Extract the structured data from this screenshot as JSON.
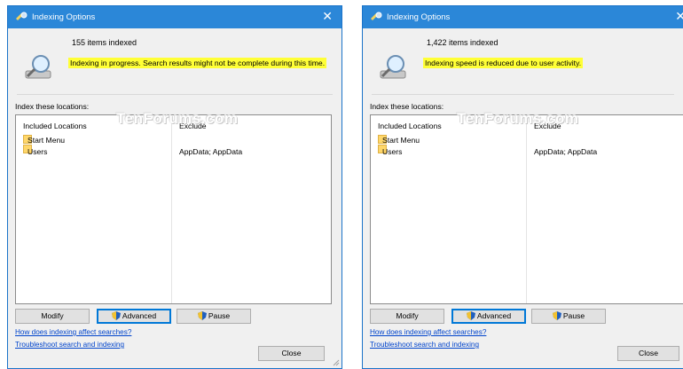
{
  "windows": [
    {
      "title": "Indexing Options",
      "close_glyph": "✕",
      "items_indexed": "155 items indexed",
      "status": "Indexing in progress. Search results might not be complete during this time.",
      "section_label": "Index these locations:",
      "columns": {
        "included": "Included Locations",
        "exclude": "Exclude"
      },
      "rows": [
        {
          "location": "Start Menu",
          "exclude": ""
        },
        {
          "location": "Users",
          "exclude": "AppData; AppData"
        }
      ],
      "watermark": "TenForums.com",
      "buttons": {
        "modify": "Modify",
        "advanced": "Advanced",
        "pause": "Pause"
      },
      "links": {
        "affect": "How does indexing affect searches?",
        "troubleshoot": "Troubleshoot search and indexing"
      },
      "close_label": "Close"
    },
    {
      "title": "Indexing Options",
      "close_glyph": "✕",
      "items_indexed": "1,422 items indexed",
      "status": "Indexing speed is reduced due to user activity.",
      "section_label": "Index these locations:",
      "columns": {
        "included": "Included Locations",
        "exclude": "Exclude"
      },
      "rows": [
        {
          "location": "Start Menu",
          "exclude": ""
        },
        {
          "location": "Users",
          "exclude": "AppData; AppData"
        }
      ],
      "watermark": "TenForums.com",
      "buttons": {
        "modify": "Modify",
        "advanced": "Advanced",
        "pause": "Pause"
      },
      "links": {
        "affect": "How does indexing affect searches?",
        "troubleshoot": "Troubleshoot search and indexing"
      },
      "close_label": "Close"
    }
  ],
  "colors": {
    "titlebar": "#2b87d8",
    "status_highlight": "#ffff36",
    "link": "#0044cc",
    "folder": "#ffd76a"
  }
}
